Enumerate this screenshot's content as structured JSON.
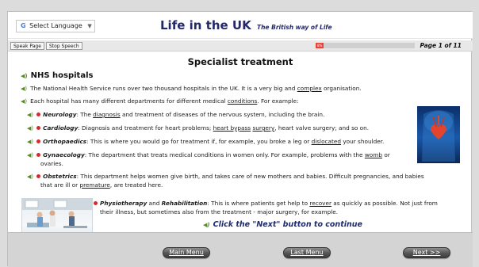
{
  "header": {
    "language_select": "Select Language",
    "language_g": "G",
    "title": "Life in the UK",
    "subtitle": "The British way of Life"
  },
  "toolbar": {
    "speak_page": "Speak Page",
    "stop_speech": "Stop Speech",
    "progress_percent": 8,
    "progress_label": "8%",
    "page_indicator": "Page 1 of 11"
  },
  "content": {
    "page_heading": "Specialist treatment",
    "section_heading": "NHS hospitals",
    "intro": {
      "a": "The National Health Service runs over two thousand hospitals in the UK. It is a very big and ",
      "b": "complex",
      "c": " organisation."
    },
    "departments": {
      "a": "Each hospital has many different departments for different medical ",
      "b": "conditions",
      "c": ". For example:"
    },
    "items": {
      "neurology": {
        "term": "Neurology",
        "a": ": The ",
        "b": "diagnosis",
        "c": " and treatment of diseases of the nervous system, including the brain."
      },
      "cardiology": {
        "term": "Cardiology",
        "a": ": Diagnosis and treatment for heart problems; ",
        "b": "heart bypass",
        "c": " ",
        "d": "surgery",
        "e": ", heart valve surgery; and so on."
      },
      "orthopaedics": {
        "term": "Orthopaedics",
        "a": ": This is where you would go for treatment if, for example, you broke a leg or ",
        "b": "dislocated",
        "c": " your shoulder."
      },
      "gynaecology": {
        "term": "Gynaecology",
        "a": ": The department that treats medical conditions in women only. For example, problems with the ",
        "b": "womb",
        "c": " or",
        "d": "ovaries."
      },
      "obstetrics": {
        "term": "Obstetrics",
        "a": ": This department helps women give birth, and takes care of new mothers and babies. Difficult pregnancies, and babies",
        "b": "that are ill or ",
        "c": "premature",
        "d": ", are treated here."
      },
      "physiotherapy": {
        "term1": "Physiotherapy",
        "and": " and ",
        "term2": "Rehabilitation",
        "a": ": This is where patients get help to ",
        "b": "recover",
        "c": " as quickly as possible. Not just from",
        "d": "their illness, but sometimes also from the treatment - major surgery, for example."
      }
    },
    "cta": "Click the \"Next\" button to continue"
  },
  "footer": {
    "main_menu": "Main Menu",
    "last_menu": "Last Menu",
    "next": "Next >>"
  },
  "colors": {
    "title": "#24286b",
    "cta": "#1c2a78",
    "bullet": "#d7282f",
    "speaker": "#5a8a2e",
    "progress": "#e0463c"
  }
}
